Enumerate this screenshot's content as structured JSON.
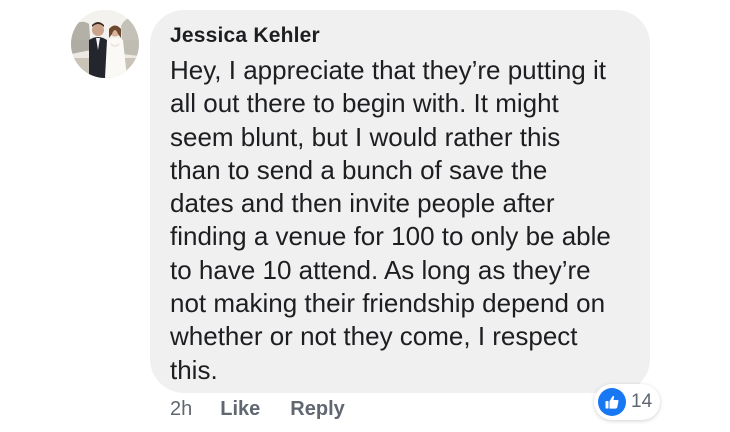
{
  "comment": {
    "author": "Jessica Kehler",
    "text_lines": [
      "Hey, I appreciate that they’re putting it",
      "all out there to begin with. It might",
      "seem blunt, but I would rather this",
      "than to send a bunch of save the",
      "dates and then invite people after",
      "finding a venue for 100 to only be able",
      "to have 10 attend. As long as they’re",
      "not making their friendship depend on",
      "whether or not they come, I respect",
      "this."
    ],
    "timestamp": "2h",
    "like_label": "Like",
    "reply_label": "Reply",
    "reaction_count": "14",
    "reaction_icon": "thumbs-up-icon",
    "colors": {
      "bubble": "#f1f0f0",
      "like_blue": "#1877f2",
      "meta_text": "#606770"
    }
  }
}
